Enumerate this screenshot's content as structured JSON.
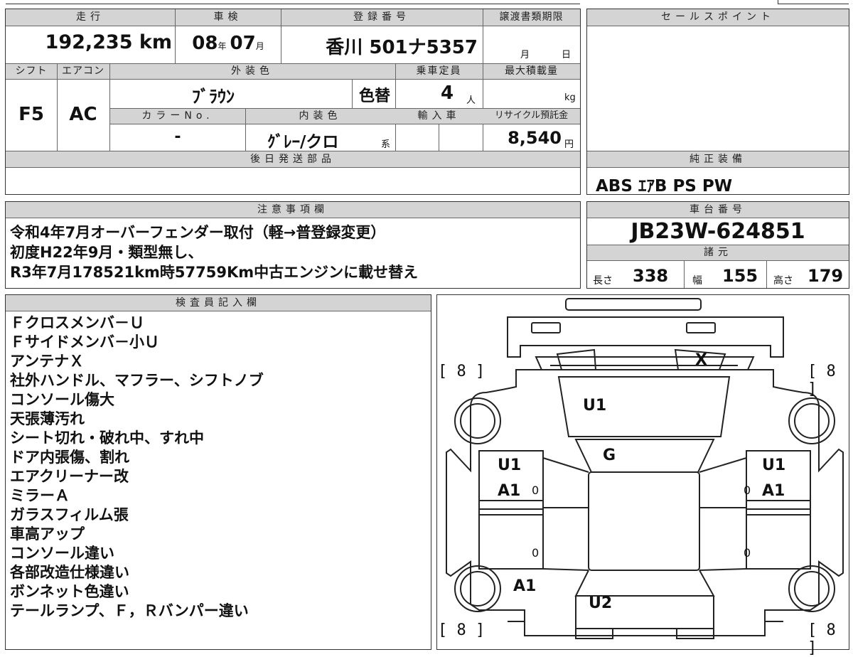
{
  "top": {
    "mileage_header": "走行",
    "mileage": "192,235 km",
    "shaken_header": "車検",
    "shaken_year": "08",
    "shaken_year_unit": "年",
    "shaken_month": "07",
    "shaken_month_unit": "月",
    "reg_header": "登録番号",
    "reg_number": "香川 501ナ5357",
    "deadline_header": "譲渡書類期限",
    "deadline_month": "月",
    "deadline_day": "日"
  },
  "spec": {
    "shift_header": "シフト",
    "shift": "F5",
    "ac_header": "エアコン",
    "ac": "AC",
    "ext_color_header": "外装色",
    "ext_color": "ﾌﾞﾗｳﾝ",
    "color_change": "色替",
    "capacity_header": "乗車定員",
    "capacity": "4",
    "capacity_unit": "人",
    "load_header": "最大積載量",
    "load_unit": "kg",
    "color_no_header": "カラーNo.",
    "color_no": "-",
    "int_color_header": "内装色",
    "int_color": "ｸﾞﾚｰ/クロ",
    "int_color_suffix": "系",
    "import_header": "輸入車",
    "recycle_header": "リサイクル預託金",
    "recycle": "8,540",
    "recycle_unit": "円",
    "later_parts_header": "後日発送部品",
    "later_parts": ""
  },
  "sales": {
    "header": "セールスポイント",
    "text": ""
  },
  "equipment": {
    "header": "純正装備",
    "items": "ABS ｴｱB PS PW"
  },
  "notes": {
    "header": "注意事項欄",
    "lines": [
      "令和4年7月オーバーフェンダー取付（軽→普登録変更）",
      "初度H22年9月・類型無し、",
      "R3年7月178521km時57759Km中古エンジンに載せ替え"
    ]
  },
  "chassis": {
    "header": "車台番号",
    "number": "JB23W-624851"
  },
  "dims": {
    "header": "諸元",
    "length_label": "長さ",
    "length": "338",
    "width_label": "幅",
    "width": "155",
    "height_label": "高さ",
    "height": "179"
  },
  "inspector": {
    "header": "検査員記入欄",
    "lines": [
      "Ｆクロスメンバ－Ｕ",
      "Ｆサイドメンバ－小Ｕ",
      "アンテナＸ",
      "社外ハンドル、マフラー、シフトノブ",
      "コンソール傷大",
      "天張薄汚れ",
      "シート切れ・破れ中、すれ中",
      "ドア内張傷、割れ",
      "エアクリーナー改",
      "ミラーＡ",
      "ガラスフィルム張",
      "車高アップ",
      "コンソール違い",
      "各部改造仕様違い",
      "ボンネット色違い",
      "テールランプ、Ｆ，Ｒバンパー違い"
    ]
  },
  "diagram": {
    "tire_tl": "[ 8 ]",
    "tire_tr": "[ 8 ]",
    "tire_bl": "[ 8 ]",
    "tire_br": "[ 8 ]",
    "mark_x": "X",
    "mark_u1_hood": "U1",
    "mark_g": "G",
    "mark_u1_left": "U1",
    "mark_a1_left": "A1",
    "mark_u1_right": "U1",
    "mark_a1_right": "A1",
    "mark_a1_rear_left": "A1",
    "mark_u2": "U2",
    "zero": "0"
  }
}
